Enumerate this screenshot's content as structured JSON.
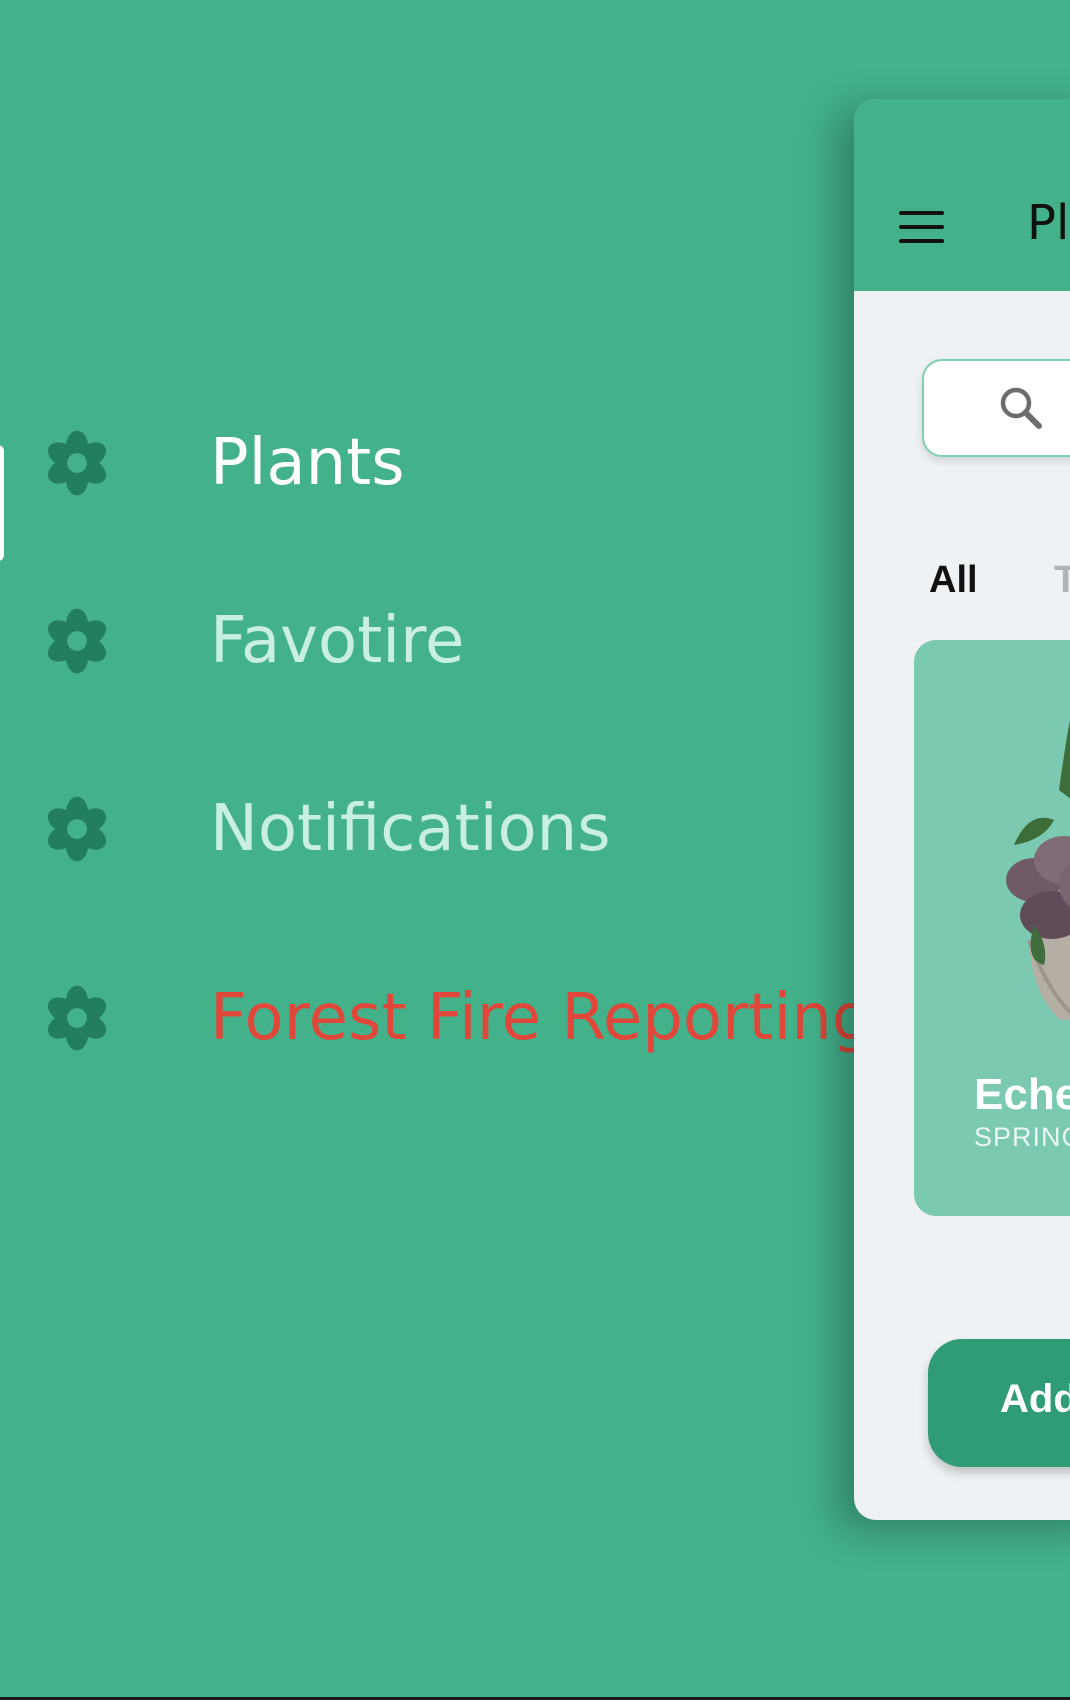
{
  "colors": {
    "background": "#43b28b",
    "nav_active": "#ffffff",
    "nav_inactive": "#c8efe1",
    "nav_alert": "#e0473a",
    "icon": "#237e5d",
    "card": "#7bc9b0",
    "button": "#2f9c77"
  },
  "drawer": {
    "items": [
      {
        "label": "Plants",
        "icon": "flower-icon",
        "state": "active"
      },
      {
        "label": "Favotire",
        "icon": "flower-icon",
        "state": "inactive"
      },
      {
        "label": "Notifications",
        "icon": "flower-icon",
        "state": "inactive"
      },
      {
        "label": "Forest Fire Reporting",
        "icon": "flower-icon",
        "state": "alert"
      }
    ]
  },
  "app": {
    "title": "Pl",
    "menu_icon": "hamburger-menu-icon",
    "search": {
      "icon": "search-icon"
    },
    "tabs": [
      {
        "label": "All",
        "active": true
      },
      {
        "label": "T",
        "active": false
      }
    ],
    "card": {
      "name": "Eche",
      "season": "SPRING",
      "image": "succulent-plant-image"
    },
    "add_button": "Add"
  }
}
